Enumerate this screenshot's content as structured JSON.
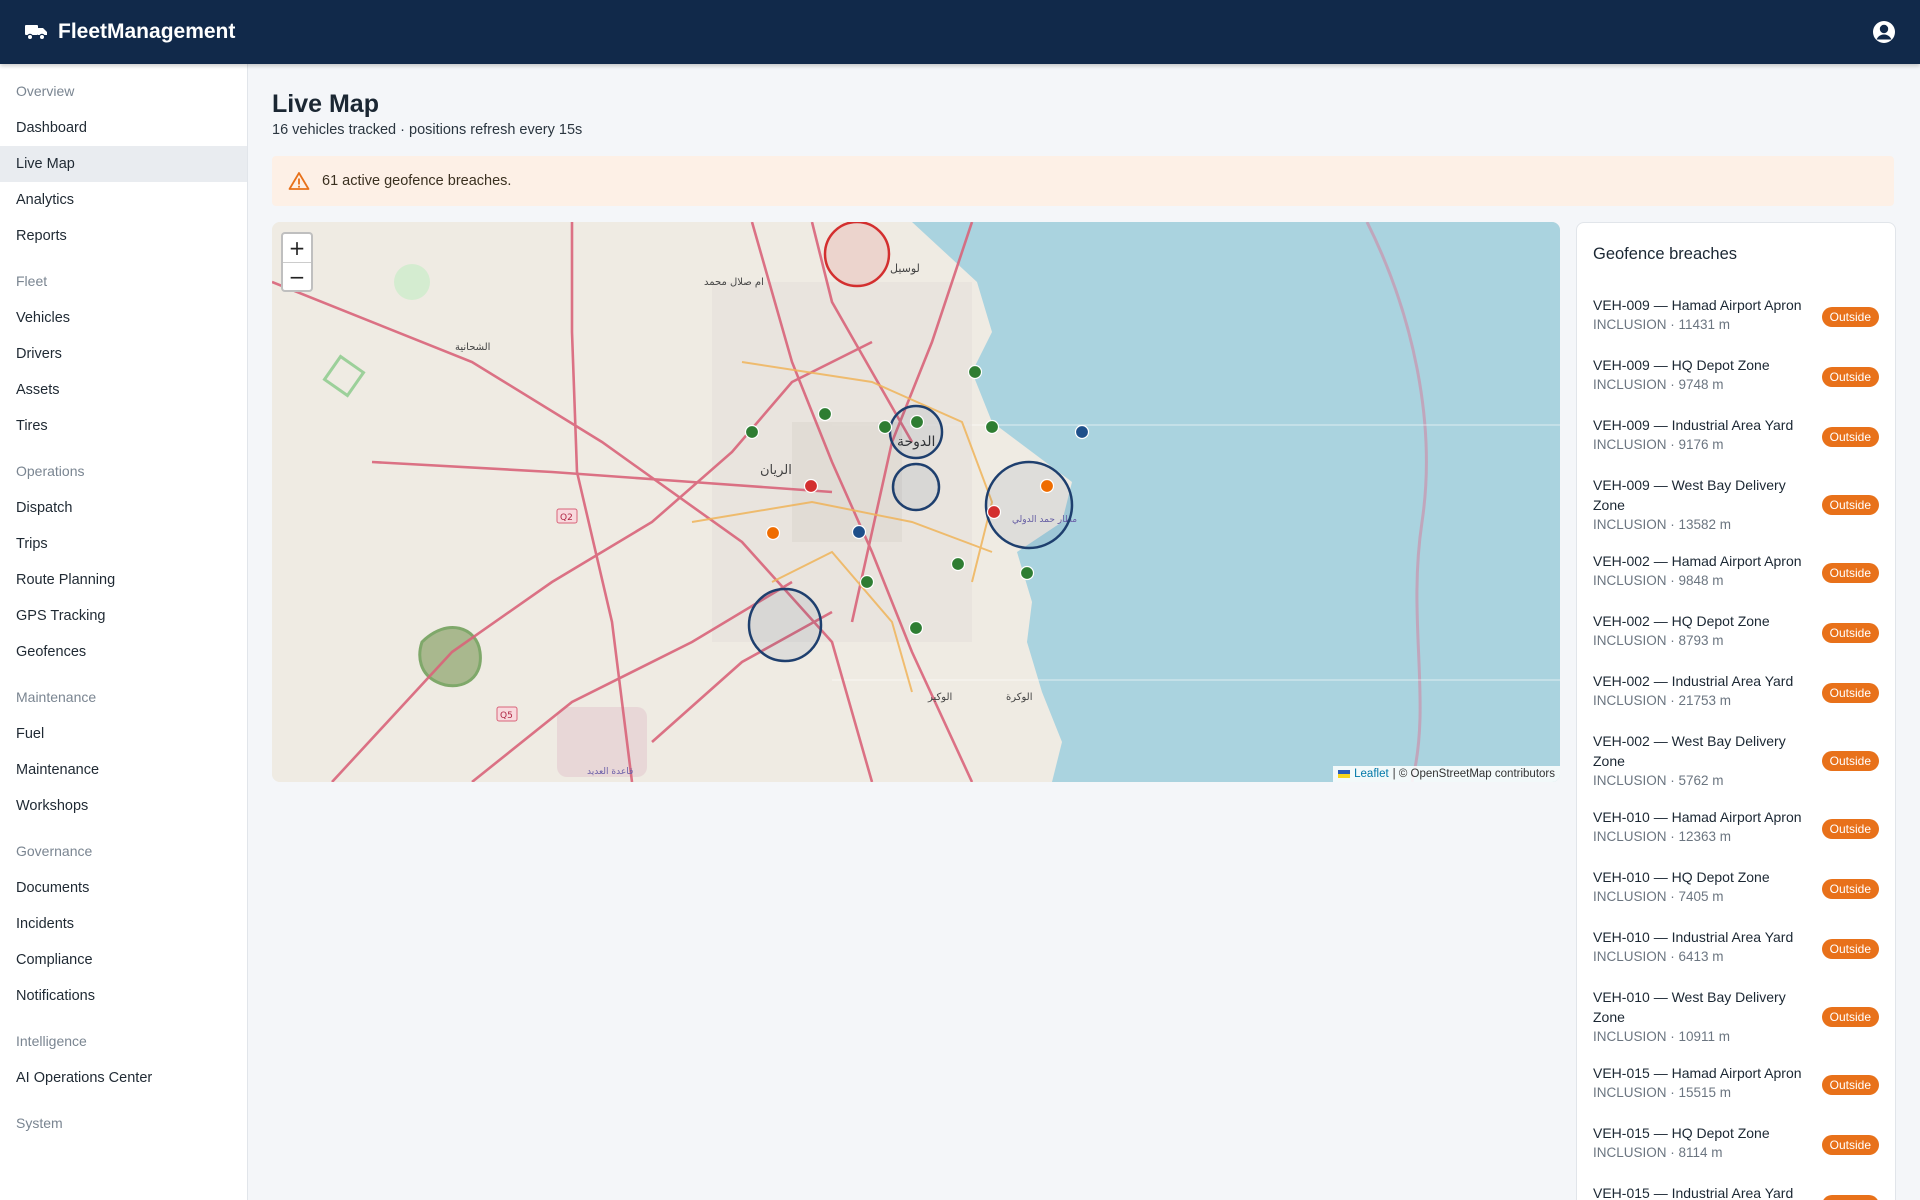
{
  "app": {
    "title": "FleetManagement"
  },
  "sidebar": {
    "sections": [
      {
        "title": "Overview",
        "items": [
          "Dashboard",
          "Live Map",
          "Analytics",
          "Reports"
        ]
      },
      {
        "title": "Fleet",
        "items": [
          "Vehicles",
          "Drivers",
          "Assets",
          "Tires"
        ]
      },
      {
        "title": "Operations",
        "items": [
          "Dispatch",
          "Trips",
          "Route Planning",
          "GPS Tracking",
          "Geofences"
        ]
      },
      {
        "title": "Maintenance",
        "items": [
          "Fuel",
          "Maintenance",
          "Workshops"
        ]
      },
      {
        "title": "Governance",
        "items": [
          "Documents",
          "Incidents",
          "Compliance",
          "Notifications"
        ]
      },
      {
        "title": "Intelligence",
        "items": [
          "AI Operations Center"
        ]
      },
      {
        "title": "System",
        "items": []
      }
    ],
    "active": "Live Map"
  },
  "page": {
    "title": "Live Map",
    "subtitle": "16 vehicles tracked · positions refresh every 15s"
  },
  "alert": {
    "text": "61 active geofence breaches.",
    "icon": "warning-icon",
    "color": "#e8711a"
  },
  "map": {
    "zoom_in": "+",
    "zoom_out": "−",
    "attribution_link": "Leaflet",
    "attribution_text": "| © OpenStreetMap contributors",
    "labels": {
      "doha": "الدوحة",
      "rayyan": "الريان",
      "lusail": "لوسيل",
      "umm_salal": "ام صلال محمد",
      "shahaniya": "الشحانية",
      "wakra": "الوكرة",
      "wukair": "الوكير",
      "udeid": "قاعدة العديد",
      "airport": "مطار حمد الدولي",
      "road_q2": "Q2",
      "road_q5": "Q5"
    },
    "colors": {
      "water": "#aad3df",
      "land": "#efebe3",
      "road": "#d9647a",
      "geofence": "#1e3f6e",
      "breach_geofence": "#d32f2f"
    },
    "vehicle_status_colors": {
      "ok": "#2e7d32",
      "warning": "#ef6c00",
      "alert": "#d32f2f",
      "idle": "#1e4f8a"
    }
  },
  "breaches_panel": {
    "title": "Geofence breaches",
    "badge_label": "Outside",
    "items": [
      {
        "title": "VEH-009 — Hamad Airport Apron",
        "sub": "INCLUSION · 11431 m"
      },
      {
        "title": "VEH-009 — HQ Depot Zone",
        "sub": "INCLUSION · 9748 m"
      },
      {
        "title": "VEH-009 — Industrial Area Yard",
        "sub": "INCLUSION · 9176 m"
      },
      {
        "title": "VEH-009 — West Bay Delivery Zone",
        "sub": "INCLUSION · 13582 m"
      },
      {
        "title": "VEH-002 — Hamad Airport Apron",
        "sub": "INCLUSION · 9848 m"
      },
      {
        "title": "VEH-002 — HQ Depot Zone",
        "sub": "INCLUSION · 8793 m"
      },
      {
        "title": "VEH-002 — Industrial Area Yard",
        "sub": "INCLUSION · 21753 m"
      },
      {
        "title": "VEH-002 — West Bay Delivery Zone",
        "sub": "INCLUSION · 5762 m"
      },
      {
        "title": "VEH-010 — Hamad Airport Apron",
        "sub": "INCLUSION · 12363 m"
      },
      {
        "title": "VEH-010 — HQ Depot Zone",
        "sub": "INCLUSION · 7405 m"
      },
      {
        "title": "VEH-010 — Industrial Area Yard",
        "sub": "INCLUSION · 6413 m"
      },
      {
        "title": "VEH-010 — West Bay Delivery Zone",
        "sub": "INCLUSION · 10911 m"
      },
      {
        "title": "VEH-015 — Hamad Airport Apron",
        "sub": "INCLUSION · 15515 m"
      },
      {
        "title": "VEH-015 — HQ Depot Zone",
        "sub": "INCLUSION · 8114 m"
      },
      {
        "title": "VEH-015 — Industrial Area Yard",
        "sub": ""
      }
    ]
  }
}
